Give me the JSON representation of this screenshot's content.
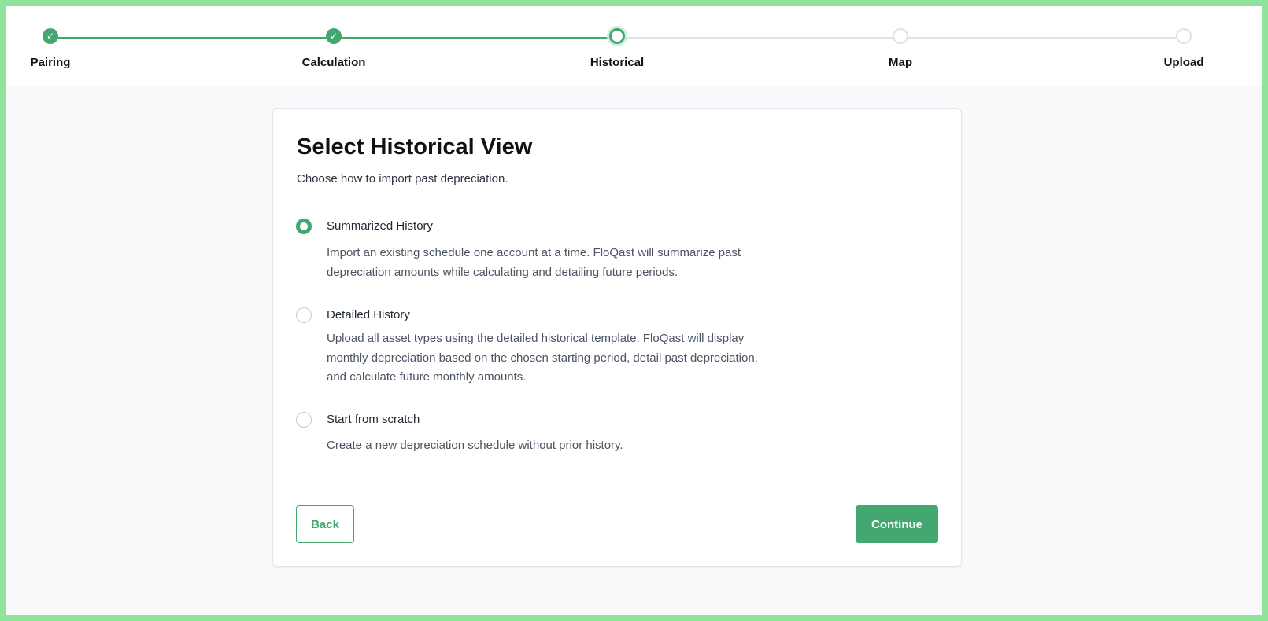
{
  "stepper": {
    "steps": [
      {
        "label": "Pairing",
        "status": "done"
      },
      {
        "label": "Calculation",
        "status": "done"
      },
      {
        "label": "Historical",
        "status": "current"
      },
      {
        "label": "Map",
        "status": "todo"
      },
      {
        "label": "Upload",
        "status": "todo"
      }
    ],
    "check_glyph": "✓"
  },
  "card": {
    "title": "Select Historical View",
    "subtitle": "Choose how to import past depreciation.",
    "options": [
      {
        "label": "Summarized History",
        "selected": true,
        "description": "Import an existing schedule one account at a time. FloQast will summarize past depreciation amounts while calculating and detailing future periods."
      },
      {
        "label": "Detailed History",
        "selected": false,
        "description": "Upload all asset types using the detailed historical template. FloQast will display monthly depreciation based on the chosen starting period, detail past depreciation, and calculate future monthly amounts."
      },
      {
        "label": "Start from scratch",
        "selected": false,
        "description": "Create a new depreciation schedule without prior history."
      }
    ],
    "back_label": "Back",
    "continue_label": "Continue"
  },
  "colors": {
    "accent": "#43a86f",
    "frame": "#90e39a",
    "page_bg": "#f8f9fa"
  }
}
